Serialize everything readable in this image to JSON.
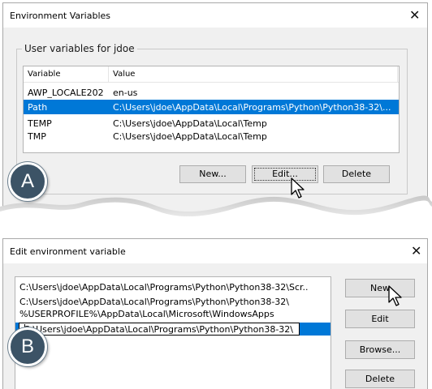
{
  "user_vars_dialog": {
    "title": "Environment Variables",
    "close_glyph": "✕",
    "group_label": "User variables for jdoe",
    "columns": [
      "Variable",
      "Value"
    ],
    "rows": [
      {
        "variable": "AWP_LOCALE202",
        "value": "en-us",
        "selected": false
      },
      {
        "variable": "Path",
        "value": "C:\\Users\\jdoe\\AppData\\Local\\Programs\\Python\\Python38-32\\...",
        "selected": true
      },
      {
        "variable": "TEMP",
        "value": "C:\\Users\\jdoe\\AppData\\Local\\Temp",
        "selected": false
      },
      {
        "variable": "TMP",
        "value": "C:\\Users\\jdoe\\AppData\\Local\\Temp",
        "selected": false
      }
    ],
    "buttons": {
      "new": "New...",
      "edit": "Edit...",
      "delete": "Delete"
    },
    "badge": "A"
  },
  "edit_dialog": {
    "title": "Edit environment variable",
    "close_glyph": "✕",
    "entries": [
      "C:\\Users\\jdoe\\AppData\\Local\\Programs\\Python\\Python38-32\\Scr..",
      "C:\\Users\\jdoe\\AppData\\Local\\Programs\\Python\\Python38-32\\",
      "%USERPROFILE%\\AppData\\Local\\Microsoft\\WindowsApps"
    ],
    "editing_value": "C:\\Users\\jdoe\\AppData\\Local\\Programs\\Python\\Python38-32\\",
    "buttons": {
      "new": "New",
      "edit": "Edit",
      "browse": "Browse...",
      "delete": "Delete"
    },
    "badge": "B"
  },
  "colors": {
    "selection": "#0078d7",
    "badge": "#3c5366",
    "dialog_bg": "#f0f0f0",
    "button_bg": "#e1e1e1"
  }
}
